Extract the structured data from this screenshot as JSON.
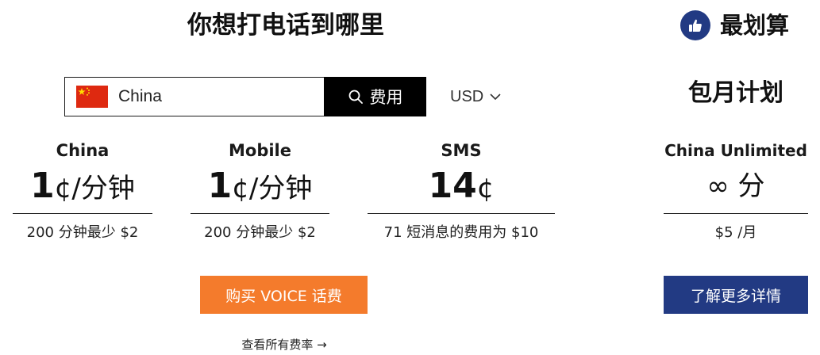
{
  "header": {
    "title": "你想打电话到哪里",
    "best_value": "最划算",
    "best_icon": "thumbs-up-icon",
    "best_icon_color": "#223a83"
  },
  "search": {
    "flag": "china-flag-icon",
    "value": "China",
    "placeholder": "",
    "button_label": "费用",
    "button_icon": "search-icon"
  },
  "currency": {
    "selected": "USD",
    "icon": "chevron-down-icon"
  },
  "rates": [
    {
      "name": "China",
      "amount": "1",
      "unit": "¢/分钟",
      "note": "200 分钟最少 $2"
    },
    {
      "name": "Mobile",
      "amount": "1",
      "unit": "¢/分钟",
      "note": "200 分钟最少 $2"
    },
    {
      "name": "SMS",
      "amount": "14",
      "unit": "¢",
      "note": "71 短消息的费用为 $10"
    }
  ],
  "plan": {
    "section_title": "包月计划",
    "name": "China Unlimited",
    "rate": "∞ 分",
    "price": "$5 /月",
    "button_label": "了解更多详情"
  },
  "actions": {
    "buy_label": "购买 VOICE 话费",
    "all_rates_label": "查看所有费率 →"
  },
  "colors": {
    "accent_orange": "#f47b2c",
    "brand_navy": "#223a83",
    "search_button": "#000000"
  }
}
